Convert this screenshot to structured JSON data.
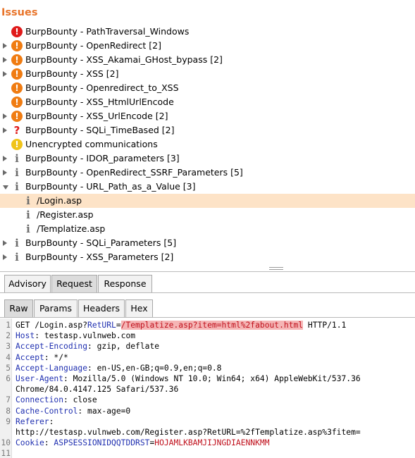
{
  "panel_title": "Issues",
  "issues": [
    {
      "label": "BurpBounty - PathTraversal_Windows",
      "severity": "high",
      "icon": "!",
      "expander": "none"
    },
    {
      "label": "BurpBounty - OpenRedirect [2]",
      "severity": "medium",
      "icon": "!",
      "expander": "closed"
    },
    {
      "label": "BurpBounty - XSS_Akamai_GHost_bypass [2]",
      "severity": "medium",
      "icon": "!",
      "expander": "closed"
    },
    {
      "label": "BurpBounty - XSS [2]",
      "severity": "medium",
      "icon": "!",
      "expander": "closed"
    },
    {
      "label": "BurpBounty - Openredirect_to_XSS",
      "severity": "medium",
      "icon": "!",
      "expander": "none"
    },
    {
      "label": "BurpBounty - XSS_HtmlUrlEncode",
      "severity": "medium",
      "icon": "!",
      "expander": "none"
    },
    {
      "label": "BurpBounty - XSS_UrlEncode [2]",
      "severity": "medium",
      "icon": "!",
      "expander": "closed"
    },
    {
      "label": "BurpBounty - SQLi_TimeBased [2]",
      "severity": "tentative",
      "icon": "?",
      "expander": "closed"
    },
    {
      "label": "Unencrypted communications",
      "severity": "low",
      "icon": "!",
      "expander": "none"
    },
    {
      "label": "BurpBounty - IDOR_parameters [3]",
      "severity": "info",
      "icon": "i",
      "expander": "closed"
    },
    {
      "label": "BurpBounty - OpenRedirect_SSRF_Parameters [5]",
      "severity": "info",
      "icon": "i",
      "expander": "closed"
    },
    {
      "label": "BurpBounty - URL_Path_as_a_Value [3]",
      "severity": "info",
      "icon": "i",
      "expander": "open"
    },
    {
      "label": "/Login.asp",
      "severity": "info",
      "icon": "i",
      "expander": "child",
      "selected": true
    },
    {
      "label": "/Register.asp",
      "severity": "info",
      "icon": "i",
      "expander": "child"
    },
    {
      "label": "/Templatize.asp",
      "severity": "info",
      "icon": "i",
      "expander": "child"
    },
    {
      "label": "BurpBounty - SQLi_Parameters [5]",
      "severity": "info",
      "icon": "i",
      "expander": "closed"
    },
    {
      "label": "BurpBounty - XSS_Parameters [2]",
      "severity": "info",
      "icon": "i",
      "expander": "closed"
    }
  ],
  "detail_tabs": [
    "Advisory",
    "Request",
    "Response"
  ],
  "detail_active": "Request",
  "view_tabs": [
    "Raw",
    "Params",
    "Headers",
    "Hex"
  ],
  "view_active": "Raw",
  "request_lines": [
    {
      "n": "1",
      "parts": [
        {
          "t": "GET /Login.asp?",
          "c": "p"
        },
        {
          "t": "RetURL",
          "c": "k"
        },
        {
          "t": "=",
          "c": "p"
        },
        {
          "t": "/Templatize.asp?item=html%2fabout.html",
          "c": "hl"
        },
        {
          "t": " HTTP/1.1",
          "c": "p"
        }
      ]
    },
    {
      "n": "2",
      "parts": [
        {
          "t": "Host",
          "c": "k"
        },
        {
          "t": ": testasp.vulnweb.com",
          "c": "p"
        }
      ]
    },
    {
      "n": "3",
      "parts": [
        {
          "t": "Accept-Encoding",
          "c": "k"
        },
        {
          "t": ": gzip, deflate",
          "c": "p"
        }
      ]
    },
    {
      "n": "4",
      "parts": [
        {
          "t": "Accept",
          "c": "k"
        },
        {
          "t": ": */*",
          "c": "p"
        }
      ]
    },
    {
      "n": "5",
      "parts": [
        {
          "t": "Accept-Language",
          "c": "k"
        },
        {
          "t": ": en-US,en-GB;q=0.9,en;q=0.8",
          "c": "p"
        }
      ]
    },
    {
      "n": "6",
      "parts": [
        {
          "t": "User-Agent",
          "c": "k"
        },
        {
          "t": ": Mozilla/5.0 (Windows NT 10.0; Win64; x64) AppleWebKit/537.36",
          "c": "p"
        }
      ]
    },
    {
      "n": "",
      "parts": [
        {
          "t": "Chrome/84.0.4147.125 Safari/537.36",
          "c": "p"
        }
      ]
    },
    {
      "n": "7",
      "parts": [
        {
          "t": "Connection",
          "c": "k"
        },
        {
          "t": ": close",
          "c": "p"
        }
      ]
    },
    {
      "n": "8",
      "parts": [
        {
          "t": "Cache-Control",
          "c": "k"
        },
        {
          "t": ": max-age=0",
          "c": "p"
        }
      ]
    },
    {
      "n": "9",
      "parts": [
        {
          "t": "Referer",
          "c": "k"
        },
        {
          "t": ":",
          "c": "p"
        }
      ]
    },
    {
      "n": "",
      "parts": [
        {
          "t": "http://testasp.vulnweb.com/Register.asp?RetURL=%2fTemplatize.asp%3fitem=",
          "c": "p"
        }
      ]
    },
    {
      "n": "10",
      "parts": [
        {
          "t": "Cookie",
          "c": "k"
        },
        {
          "t": ": ",
          "c": "p"
        },
        {
          "t": "ASPSESSIONIDQQTDDRST",
          "c": "k"
        },
        {
          "t": "=",
          "c": "p"
        },
        {
          "t": "HOJAMLKBAMJIJNGDIAENNKMM",
          "c": "v"
        }
      ]
    },
    {
      "n": "11",
      "parts": []
    }
  ],
  "colors": {
    "title": "#e8742a",
    "high": "#e01b1b",
    "medium": "#f07c12",
    "low": "#f0c41a",
    "selected_row": "#fde3c7",
    "header_key": "#1f2fb0",
    "value": "#c0101c"
  }
}
